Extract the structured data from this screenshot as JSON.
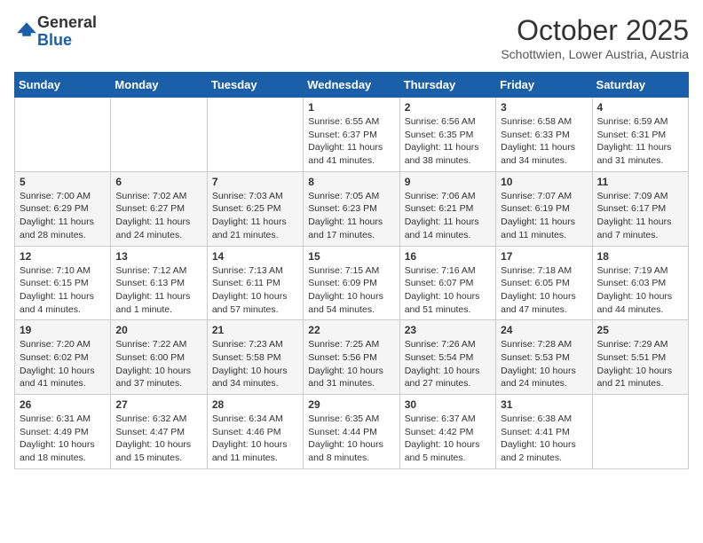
{
  "header": {
    "logo_general": "General",
    "logo_blue": "Blue",
    "month_title": "October 2025",
    "subtitle": "Schottwien, Lower Austria, Austria"
  },
  "weekdays": [
    "Sunday",
    "Monday",
    "Tuesday",
    "Wednesday",
    "Thursday",
    "Friday",
    "Saturday"
  ],
  "weeks": [
    [
      {
        "day": "",
        "content": ""
      },
      {
        "day": "",
        "content": ""
      },
      {
        "day": "",
        "content": ""
      },
      {
        "day": "1",
        "content": "Sunrise: 6:55 AM\nSunset: 6:37 PM\nDaylight: 11 hours and 41 minutes."
      },
      {
        "day": "2",
        "content": "Sunrise: 6:56 AM\nSunset: 6:35 PM\nDaylight: 11 hours and 38 minutes."
      },
      {
        "day": "3",
        "content": "Sunrise: 6:58 AM\nSunset: 6:33 PM\nDaylight: 11 hours and 34 minutes."
      },
      {
        "day": "4",
        "content": "Sunrise: 6:59 AM\nSunset: 6:31 PM\nDaylight: 11 hours and 31 minutes."
      }
    ],
    [
      {
        "day": "5",
        "content": "Sunrise: 7:00 AM\nSunset: 6:29 PM\nDaylight: 11 hours and 28 minutes."
      },
      {
        "day": "6",
        "content": "Sunrise: 7:02 AM\nSunset: 6:27 PM\nDaylight: 11 hours and 24 minutes."
      },
      {
        "day": "7",
        "content": "Sunrise: 7:03 AM\nSunset: 6:25 PM\nDaylight: 11 hours and 21 minutes."
      },
      {
        "day": "8",
        "content": "Sunrise: 7:05 AM\nSunset: 6:23 PM\nDaylight: 11 hours and 17 minutes."
      },
      {
        "day": "9",
        "content": "Sunrise: 7:06 AM\nSunset: 6:21 PM\nDaylight: 11 hours and 14 minutes."
      },
      {
        "day": "10",
        "content": "Sunrise: 7:07 AM\nSunset: 6:19 PM\nDaylight: 11 hours and 11 minutes."
      },
      {
        "day": "11",
        "content": "Sunrise: 7:09 AM\nSunset: 6:17 PM\nDaylight: 11 hours and 7 minutes."
      }
    ],
    [
      {
        "day": "12",
        "content": "Sunrise: 7:10 AM\nSunset: 6:15 PM\nDaylight: 11 hours and 4 minutes."
      },
      {
        "day": "13",
        "content": "Sunrise: 7:12 AM\nSunset: 6:13 PM\nDaylight: 11 hours and 1 minute."
      },
      {
        "day": "14",
        "content": "Sunrise: 7:13 AM\nSunset: 6:11 PM\nDaylight: 10 hours and 57 minutes."
      },
      {
        "day": "15",
        "content": "Sunrise: 7:15 AM\nSunset: 6:09 PM\nDaylight: 10 hours and 54 minutes."
      },
      {
        "day": "16",
        "content": "Sunrise: 7:16 AM\nSunset: 6:07 PM\nDaylight: 10 hours and 51 minutes."
      },
      {
        "day": "17",
        "content": "Sunrise: 7:18 AM\nSunset: 6:05 PM\nDaylight: 10 hours and 47 minutes."
      },
      {
        "day": "18",
        "content": "Sunrise: 7:19 AM\nSunset: 6:03 PM\nDaylight: 10 hours and 44 minutes."
      }
    ],
    [
      {
        "day": "19",
        "content": "Sunrise: 7:20 AM\nSunset: 6:02 PM\nDaylight: 10 hours and 41 minutes."
      },
      {
        "day": "20",
        "content": "Sunrise: 7:22 AM\nSunset: 6:00 PM\nDaylight: 10 hours and 37 minutes."
      },
      {
        "day": "21",
        "content": "Sunrise: 7:23 AM\nSunset: 5:58 PM\nDaylight: 10 hours and 34 minutes."
      },
      {
        "day": "22",
        "content": "Sunrise: 7:25 AM\nSunset: 5:56 PM\nDaylight: 10 hours and 31 minutes."
      },
      {
        "day": "23",
        "content": "Sunrise: 7:26 AM\nSunset: 5:54 PM\nDaylight: 10 hours and 27 minutes."
      },
      {
        "day": "24",
        "content": "Sunrise: 7:28 AM\nSunset: 5:53 PM\nDaylight: 10 hours and 24 minutes."
      },
      {
        "day": "25",
        "content": "Sunrise: 7:29 AM\nSunset: 5:51 PM\nDaylight: 10 hours and 21 minutes."
      }
    ],
    [
      {
        "day": "26",
        "content": "Sunrise: 6:31 AM\nSunset: 4:49 PM\nDaylight: 10 hours and 18 minutes."
      },
      {
        "day": "27",
        "content": "Sunrise: 6:32 AM\nSunset: 4:47 PM\nDaylight: 10 hours and 15 minutes."
      },
      {
        "day": "28",
        "content": "Sunrise: 6:34 AM\nSunset: 4:46 PM\nDaylight: 10 hours and 11 minutes."
      },
      {
        "day": "29",
        "content": "Sunrise: 6:35 AM\nSunset: 4:44 PM\nDaylight: 10 hours and 8 minutes."
      },
      {
        "day": "30",
        "content": "Sunrise: 6:37 AM\nSunset: 4:42 PM\nDaylight: 10 hours and 5 minutes."
      },
      {
        "day": "31",
        "content": "Sunrise: 6:38 AM\nSunset: 4:41 PM\nDaylight: 10 hours and 2 minutes."
      },
      {
        "day": "",
        "content": ""
      }
    ]
  ]
}
